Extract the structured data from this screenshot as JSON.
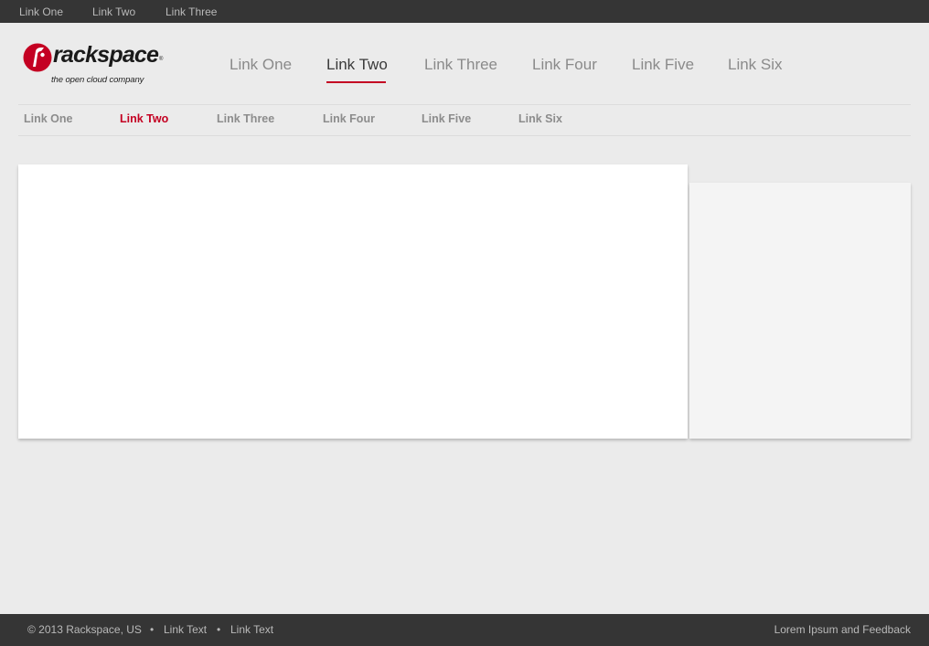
{
  "top_bar": {
    "links": [
      "Link One",
      "Link Two",
      "Link Three"
    ]
  },
  "logo": {
    "wordmark": "rackspace",
    "registered": "®",
    "tagline": "the open cloud company"
  },
  "main_nav": {
    "items": [
      "Link One",
      "Link Two",
      "Link Three",
      "Link Four",
      "Link Five",
      "Link Six"
    ],
    "active": "Link Two"
  },
  "sub_nav": {
    "items": [
      "Link One",
      "Link Two",
      "Link Three",
      "Link Four",
      "Link Five",
      "Link Six"
    ],
    "active": "Link Two"
  },
  "footer": {
    "copyright": "© 2013 Rackspace, US",
    "separator": "•",
    "links": [
      "Link Text",
      "Link Text"
    ],
    "feedback": "Lorem Ipsum and Feedback"
  },
  "colors": {
    "accent": "#c40022",
    "bar_background": "#353535",
    "page_background": "#ebebeb"
  },
  "icons": {
    "logo_mark": "rackspace-logo-icon"
  }
}
